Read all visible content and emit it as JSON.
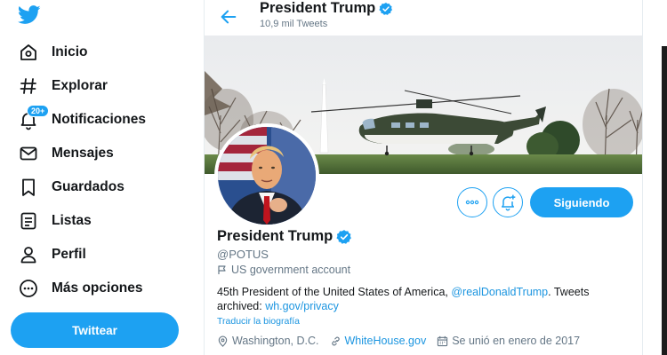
{
  "sidebar": {
    "nav": [
      {
        "label": "Inicio",
        "icon": "home-icon"
      },
      {
        "label": "Explorar",
        "icon": "hashtag-icon"
      },
      {
        "label": "Notificaciones",
        "icon": "bell-icon",
        "badge": "20+"
      },
      {
        "label": "Mensajes",
        "icon": "mail-icon"
      },
      {
        "label": "Guardados",
        "icon": "bookmark-icon"
      },
      {
        "label": "Listas",
        "icon": "list-icon"
      },
      {
        "label": "Perfil",
        "icon": "person-icon"
      },
      {
        "label": "Más opciones",
        "icon": "more-circle-icon"
      }
    ],
    "tweet_button": "Twittear"
  },
  "header": {
    "title": "President Trump",
    "tweet_count": "10,9 mil Tweets"
  },
  "profile": {
    "name": "President Trump",
    "handle": "@POTUS",
    "account_type": "US government account",
    "bio_text": "45th President of the United States of America, ",
    "bio_mention": "@realDonaldTrump",
    "bio_text2": ". Tweets archived: ",
    "bio_link": "wh.gov/privacy",
    "translate": "Traducir la biografía",
    "location": "Washington, D.C.",
    "website": "WhiteHouse.gov",
    "joined": "Se unió en enero de 2017",
    "follow_button": "Siguiendo"
  },
  "colors": {
    "accent": "#1da1f2",
    "link": "#1b95e0",
    "muted": "#657786",
    "text": "#14171a"
  }
}
